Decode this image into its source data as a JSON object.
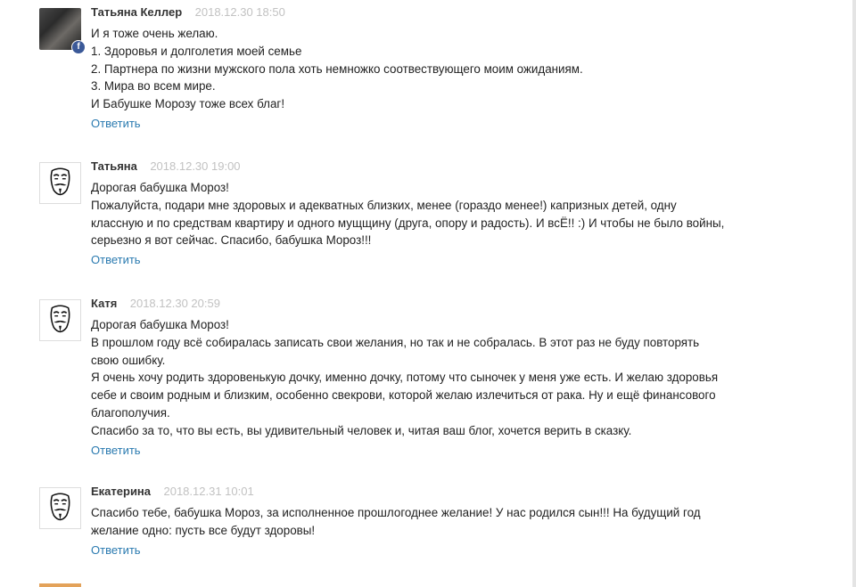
{
  "comments": [
    {
      "author": "Татьяна Келлер",
      "date": "2018.12.30 18:50",
      "avatar_icon": "facebook-photo-avatar",
      "lines": [
        "И я тоже очень желаю.",
        "1. Здоровья и долголетия моей семье",
        "2. Партнера по жизни мужского пола хоть немножко соотвествующего моим ожиданиям.",
        "3. Мира во всем мире.",
        "И Бабушке Морозу тоже всех благ!"
      ],
      "reply_label": "Ответить"
    },
    {
      "author": "Татьяна",
      "date": "2018.12.30 19:00",
      "avatar_icon": "guy-fawkes-mask-avatar",
      "lines": [
        "Дорогая бабушка Мороз!",
        "Пожалуйста, подари мне здоровых и адекватных близких, менее (гораздо менее!) капризных детей, одну",
        "классную и по средствам квартиру и одного мущщину (друга, опору и радость). И всЁ!! :) И чтобы не было войны,",
        "серьезно я вот сейчас. Спасибо, бабушка Мороз!!!"
      ],
      "reply_label": "Ответить"
    },
    {
      "author": "Катя",
      "date": "2018.12.30 20:59",
      "avatar_icon": "guy-fawkes-mask-avatar",
      "lines": [
        "Дорогая бабушка Мороз!",
        "В прошлом году всё собиралась записать свои желания, но так и не собралась. В этот раз не буду повторять",
        "свою ошибку.",
        "Я очень хочу родить здоровенькую дочку, именно дочку, потому что сыночек у меня уже есть.  И желаю здоровья",
        "себе и своим родным и близким, особенно свекрови, которой желаю излечиться от рака. Ну и ещё финансового",
        "благополучия.",
        "Спасибо за то, что вы есть, вы удивительный человек и, читая ваш блог, хочется верить в сказку."
      ],
      "reply_label": "Ответить"
    },
    {
      "author": "Екатерина",
      "date": "2018.12.31 10:01",
      "avatar_icon": "guy-fawkes-mask-avatar",
      "lines": [
        "Спасибо тебе, бабушка Мороз, за исполненное прошлогоднее желание! У нас родился сын!!! На будущий год",
        "желание одно: пусть все  будут здоровы!"
      ],
      "reply_label": "Ответить"
    }
  ],
  "colors": {
    "link": "#2a7ab0",
    "date": "#c2c2c2",
    "facebook_badge": "#3b5998"
  }
}
